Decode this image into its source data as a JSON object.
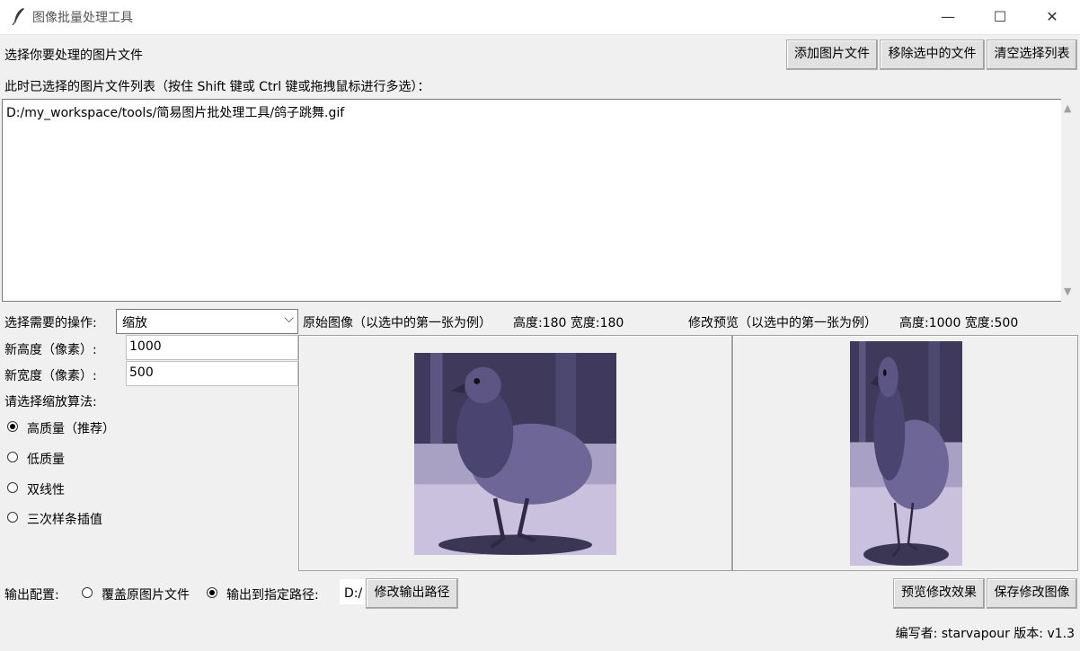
{
  "window": {
    "title": "图像批量处理工具",
    "minimize": "—",
    "maximize": "☐",
    "close": "✕"
  },
  "top": {
    "prompt": "选择你要处理的图片文件",
    "add_button": "添加图片文件",
    "remove_button": "移除选中的文件",
    "clear_button": "清空选择列表"
  },
  "list": {
    "caption": "此时已选择的图片文件列表（按住 Shift 键或 Ctrl 键或拖拽鼠标进行多选）：",
    "items": [
      "D:/my_workspace/tools/简易图片批处理工具/鸽子跳舞.gif"
    ]
  },
  "operation": {
    "label": "选择需要的操作:",
    "selected": "缩放",
    "height_label": "新高度（像素）:",
    "height_value": "1000",
    "width_label": "新宽度（像素）:",
    "width_value": "500",
    "algo_label": "请选择缩放算法:",
    "algorithms": [
      {
        "label": "高质量（推荐）",
        "checked": true
      },
      {
        "label": "低质量",
        "checked": false
      },
      {
        "label": "双线性",
        "checked": false
      },
      {
        "label": "三次样条插值",
        "checked": false
      }
    ]
  },
  "original": {
    "caption": "原始图像（以选中的第一张为例）",
    "size": "高度:180 宽度:180"
  },
  "preview": {
    "caption": "修改预览（以选中的第一张为例）",
    "size": "高度:1000 宽度:500"
  },
  "output": {
    "label": "输出配置:",
    "overwrite_label": "覆盖原图片文件",
    "overwrite_checked": false,
    "custom_label": "输出到指定路径:",
    "custom_checked": true,
    "path_value": "D:/",
    "change_path_button": "修改输出路径",
    "preview_button": "预览修改效果",
    "save_button": "保存修改图像"
  },
  "footer": {
    "text": "编写者: starvapour   版本: v1.3"
  },
  "colors": {
    "image_tint": "#5d5583",
    "image_bg": "#c9c1dd"
  }
}
